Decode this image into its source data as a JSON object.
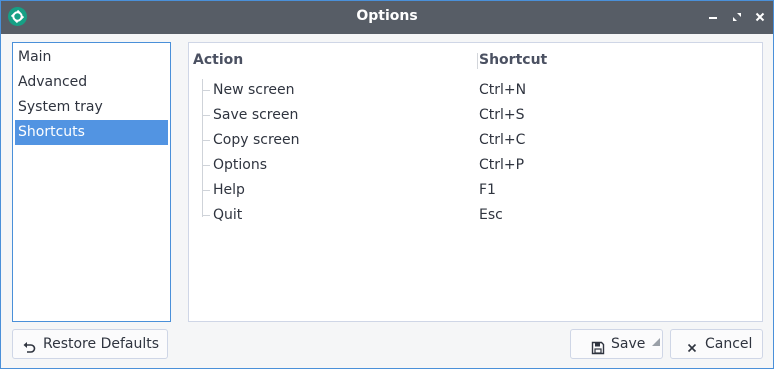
{
  "window": {
    "title": "Options"
  },
  "nav": {
    "items": [
      {
        "label": "Main",
        "selected": false
      },
      {
        "label": "Advanced",
        "selected": false
      },
      {
        "label": "System tray",
        "selected": false
      },
      {
        "label": "Shortcuts",
        "selected": true
      }
    ]
  },
  "shortcuts": {
    "headers": {
      "action": "Action",
      "shortcut": "Shortcut"
    },
    "rows": [
      {
        "action": "New screen",
        "shortcut": "Ctrl+N"
      },
      {
        "action": "Save screen",
        "shortcut": "Ctrl+S"
      },
      {
        "action": "Copy screen",
        "shortcut": "Ctrl+C"
      },
      {
        "action": "Options",
        "shortcut": "Ctrl+P"
      },
      {
        "action": "Help",
        "shortcut": "F1"
      },
      {
        "action": "Quit",
        "shortcut": "Esc"
      }
    ]
  },
  "buttons": {
    "restore": "Restore Defaults",
    "save": "Save",
    "cancel": "Cancel"
  },
  "colors": {
    "titlebar": "#575d66",
    "selection": "#5294e2",
    "focus_border": "#4a90d9",
    "app_icon": "#16a085"
  },
  "icons": {
    "app": "screengrab-app-icon",
    "minimize": "minimize-icon",
    "maximize": "maximize-icon",
    "close": "close-icon",
    "restore": "undo-arrow-icon",
    "save": "floppy-disk-icon",
    "cancel": "x-icon"
  }
}
